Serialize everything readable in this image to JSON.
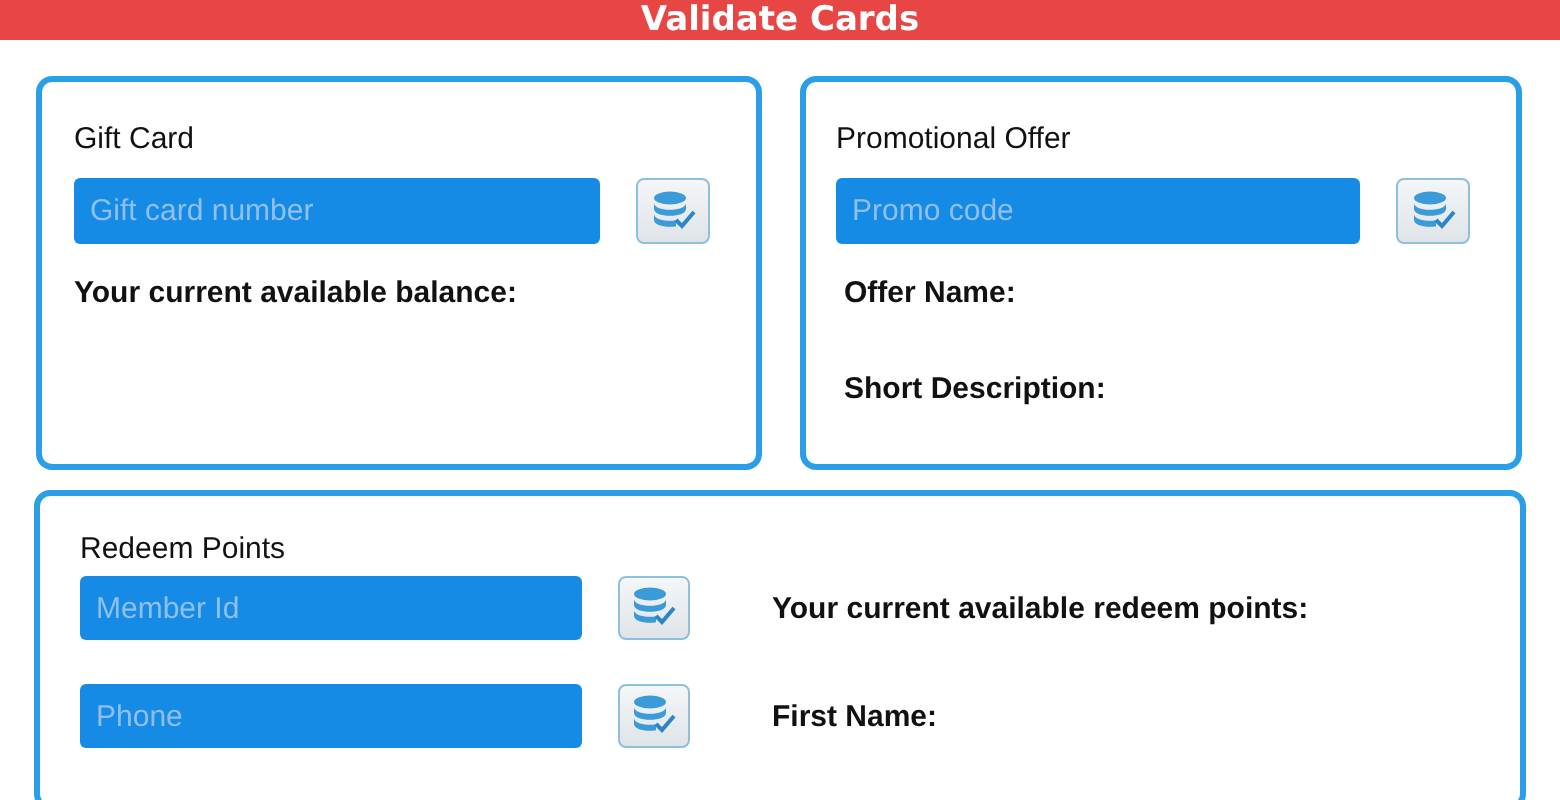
{
  "header": {
    "title": "Validate Cards"
  },
  "gift_card": {
    "title": "Gift Card",
    "field": {
      "placeholder": "Gift card number"
    },
    "labels": [
      "Your current available balance:"
    ]
  },
  "promo": {
    "title": "Promotional Offer",
    "field": {
      "placeholder": "Promo code"
    },
    "labels": [
      "Offer Name:",
      "Short Description:"
    ]
  },
  "redeem": {
    "title": "Redeem Points",
    "rows": [
      {
        "field": {
          "placeholder": "Member Id"
        },
        "label": "Your current available redeem points:"
      },
      {
        "field": {
          "placeholder": "Phone"
        },
        "label": "First Name:"
      }
    ]
  }
}
